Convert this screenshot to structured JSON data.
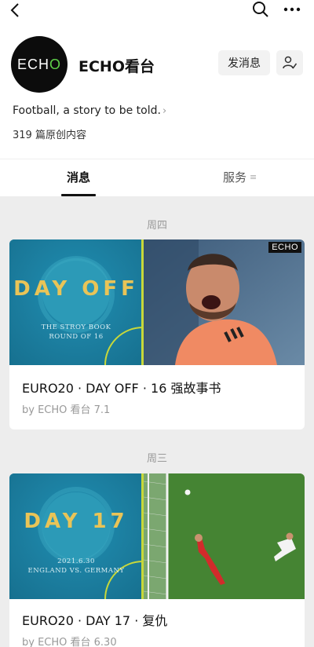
{
  "header": {
    "back_icon": "chevron-left-icon",
    "search_icon": "search-icon",
    "more_icon": "more-dots-icon"
  },
  "account": {
    "avatar_text_1": "EC",
    "avatar_text_2": "H",
    "avatar_text_3": "O",
    "name": "ECHO看台",
    "message_button": "发消息",
    "follow_icon": "user-check-icon",
    "intro": "Football, a story to be told.",
    "article_count": "319 篇原创内容"
  },
  "tabs": [
    {
      "label": "消息",
      "active": true
    },
    {
      "label": "服务",
      "active": false
    }
  ],
  "feed": [
    {
      "day": "周四",
      "title": "EURO20 · DAY OFF · 16 强故事书",
      "meta": "by ECHO 看台 7.1",
      "thumb": {
        "big": "DAY OFF",
        "small_1": "THE STROY BOOK",
        "small_2": "ROUND OF 16",
        "stamp": "ECHO"
      }
    },
    {
      "day": "周三",
      "title": "EURO20 · DAY 17 · 复仇",
      "meta": "by ECHO 看台 6.30",
      "thumb": {
        "big": "DAY 17",
        "small_1": "2021.6.30",
        "small_2": "ENGLAND VS. GERMANY"
      }
    }
  ],
  "colors": {
    "accent_yellow": "#e9c457",
    "pitch_blue": "#1d84a6",
    "divider_green": "#c8d83a",
    "echo_green": "#5fd14a"
  }
}
